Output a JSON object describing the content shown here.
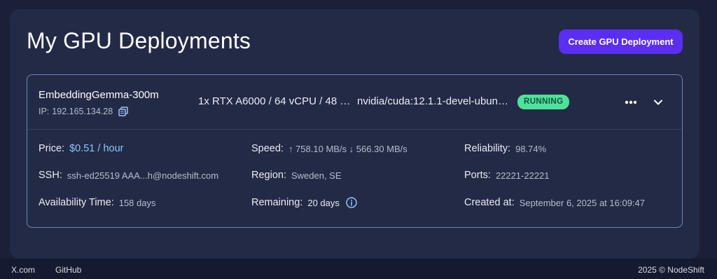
{
  "page": {
    "title": "My GPU Deployments",
    "create_label": "Create GPU Deployment"
  },
  "deployment": {
    "name": "EmbeddingGemma-300m",
    "ip_label": "IP:",
    "ip": "192.165.134.28",
    "gpu_spec": "1x RTX A6000 / 64 vCPU / 48 …",
    "image": "nvidia/cuda:12.1.1-devel-ubun…",
    "status": "RUNNING",
    "details": {
      "price_label": "Price:",
      "price": "$0.51 / hour",
      "speed_label": "Speed:",
      "speed": "↑ 758.10 MB/s ↓ 566.30 MB/s",
      "reliability_label": "Reliability:",
      "reliability": "98.74%",
      "ssh_label": "SSH:",
      "ssh": "ssh-ed25519 AAA...h@nodeshift.com",
      "region_label": "Region:",
      "region": "Sweden, SE",
      "ports_label": "Ports:",
      "ports": "22221-22221",
      "availability_label": "Availability Time:",
      "availability": "158 days",
      "remaining_label": "Remaining:",
      "remaining": "20 days",
      "created_label": "Created at:",
      "created": "September 6, 2025 at 16:09:47"
    }
  },
  "footer": {
    "link1": "X.com",
    "link2": "GitHub",
    "copyright": "2025 © NodeShift"
  },
  "colors": {
    "accent": "#5b2ef2",
    "status_bg": "#4ee39a",
    "price": "#8cc4ff",
    "background": "#1b2038",
    "panel": "#232a45"
  },
  "icons": [
    "copy-icon",
    "more-horizontal-icon",
    "chevron-down-icon",
    "info-icon"
  ]
}
